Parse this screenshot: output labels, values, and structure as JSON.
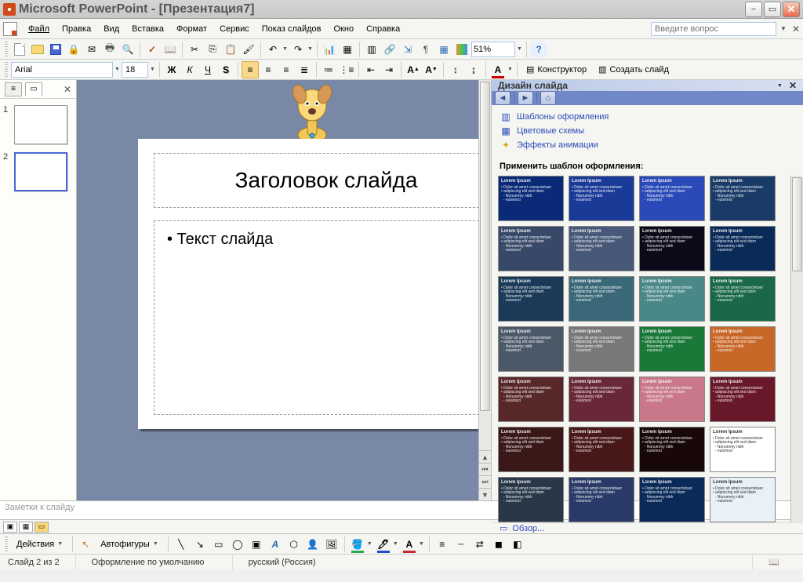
{
  "title": "Microsoft PowerPoint - [Презентация7]",
  "menu": {
    "file": "Файл",
    "edit": "Правка",
    "view": "Вид",
    "insert": "Вставка",
    "format": "Формат",
    "tools": "Сервис",
    "slideshow": "Показ слайдов",
    "window": "Окно",
    "help": "Справка",
    "search_placeholder": "Введите вопрос"
  },
  "toolbar": {
    "zoom": "51%"
  },
  "format_bar": {
    "font": "Arial",
    "size": "18",
    "bold": "Ж",
    "italic": "К",
    "underline": "Ч",
    "shadow": "S",
    "designer": "Конструктор",
    "new_slide": "Создать слайд"
  },
  "thumbs": {
    "slides": [
      "1",
      "2"
    ],
    "selected": 2
  },
  "slide": {
    "title": "Заголовок слайда",
    "body": "Текст слайда"
  },
  "notes": {
    "placeholder": "Заметки к слайду"
  },
  "taskpane": {
    "title": "Дизайн слайда",
    "links": {
      "templates": "Шаблоны оформления",
      "colors": "Цветовые схемы",
      "effects": "Эффекты анимации"
    },
    "apply_header": "Применить шаблон оформления:",
    "browse": "Обзор..."
  },
  "templates": [
    {
      "bg": "#0a2a78"
    },
    {
      "bg": "#1a3a98"
    },
    {
      "bg": "#2a4ab8"
    },
    {
      "bg": "#1a3a68"
    },
    {
      "bg": "#384868"
    },
    {
      "bg": "#485878"
    },
    {
      "bg": "#0a0a18"
    },
    {
      "bg": "#0a2a58"
    },
    {
      "bg": "#1a3a58"
    },
    {
      "bg": "#3a6878"
    },
    {
      "bg": "#4a8888"
    },
    {
      "bg": "#1a6848"
    },
    {
      "bg": "#4a5868"
    },
    {
      "bg": "#787878"
    },
    {
      "bg": "#1a7838"
    },
    {
      "bg": "#c86828"
    },
    {
      "bg": "#582828"
    },
    {
      "bg": "#682838"
    },
    {
      "bg": "#c87888"
    },
    {
      "bg": "#681828"
    },
    {
      "bg": "#3a1818"
    },
    {
      "bg": "#481818"
    },
    {
      "bg": "#180808"
    },
    {
      "bg": "#ffffff",
      "fg": "#333"
    },
    {
      "bg": "#283848"
    },
    {
      "bg": "#2a3a68"
    },
    {
      "bg": "#0a2a58"
    },
    {
      "bg": "#e8f0f8",
      "fg": "#333"
    }
  ],
  "drawbar": {
    "actions": "Действия",
    "autoshapes": "Автофигуры"
  },
  "statusbar": {
    "slide": "Слайд 2 из 2",
    "design": "Оформление по умолчанию",
    "lang": "русский (Россия)"
  }
}
